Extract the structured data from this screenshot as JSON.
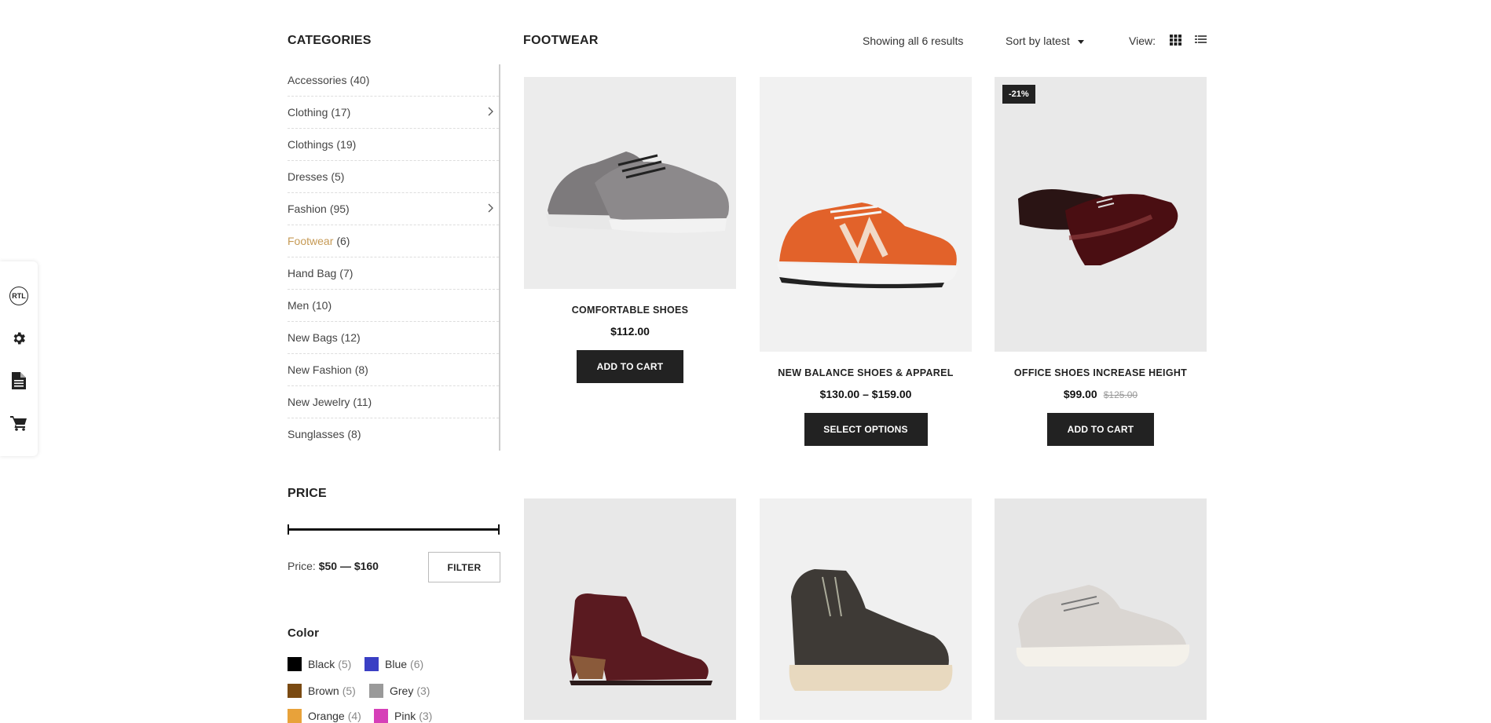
{
  "tools": {
    "rtl_label": "RTL"
  },
  "sidebar": {
    "categories_title": "CATEGORIES",
    "categories": [
      {
        "name": "Accessories",
        "count": "(40)"
      },
      {
        "name": "Clothing",
        "count": "(17)"
      },
      {
        "name": "Clothings",
        "count": "(19)"
      },
      {
        "name": "Dresses",
        "count": "(5)"
      },
      {
        "name": "Fashion",
        "count": "(95)"
      },
      {
        "name": "Footwear",
        "count": "(6)"
      },
      {
        "name": "Hand Bag",
        "count": "(7)"
      },
      {
        "name": "Men",
        "count": "(10)"
      },
      {
        "name": "New Bags",
        "count": "(12)"
      },
      {
        "name": "New Fashion",
        "count": "(8)"
      },
      {
        "name": "New Jewelry",
        "count": "(11)"
      },
      {
        "name": "Sunglasses",
        "count": "(8)"
      }
    ],
    "price_title": "PRICE",
    "price_prefix": "Price:",
    "price_min": "$50",
    "price_sep": "—",
    "price_max": "$160",
    "filter_label": "FILTER",
    "color_title": "Color",
    "colors": [
      {
        "name": "Black",
        "count": "(5)",
        "hex": "#000000"
      },
      {
        "name": "Blue",
        "count": "(6)",
        "hex": "#3a3fc4"
      },
      {
        "name": "Brown",
        "count": "(5)",
        "hex": "#7a4a12"
      },
      {
        "name": "Grey",
        "count": "(3)",
        "hex": "#9a9a9a"
      },
      {
        "name": "Orange",
        "count": "(4)",
        "hex": "#e8a23a"
      },
      {
        "name": "Pink",
        "count": "(3)",
        "hex": "#d63fb8"
      }
    ]
  },
  "main": {
    "title": "FOOTWEAR",
    "result_count": "Showing all 6 results",
    "sort_label": "Sort by latest",
    "view_label": "View:"
  },
  "products": [
    {
      "title": "COMFORTABLE SHOES",
      "price": "$112.00",
      "button": "ADD TO CART"
    },
    {
      "title": "NEW BALANCE SHOES & APPAREL",
      "price": "$130.00 – $159.00",
      "button": "SELECT OPTIONS"
    },
    {
      "title": "OFFICE SHOES INCREASE HEIGHT",
      "price": "$99.00",
      "old_price": "$125.00",
      "badge": "-21%",
      "button": "ADD TO CART"
    },
    {
      "title": "",
      "price": ""
    },
    {
      "title": "",
      "price": ""
    },
    {
      "title": "",
      "price": ""
    }
  ],
  "colors": {
    "accent": "#c69a55",
    "dark": "#222222"
  }
}
